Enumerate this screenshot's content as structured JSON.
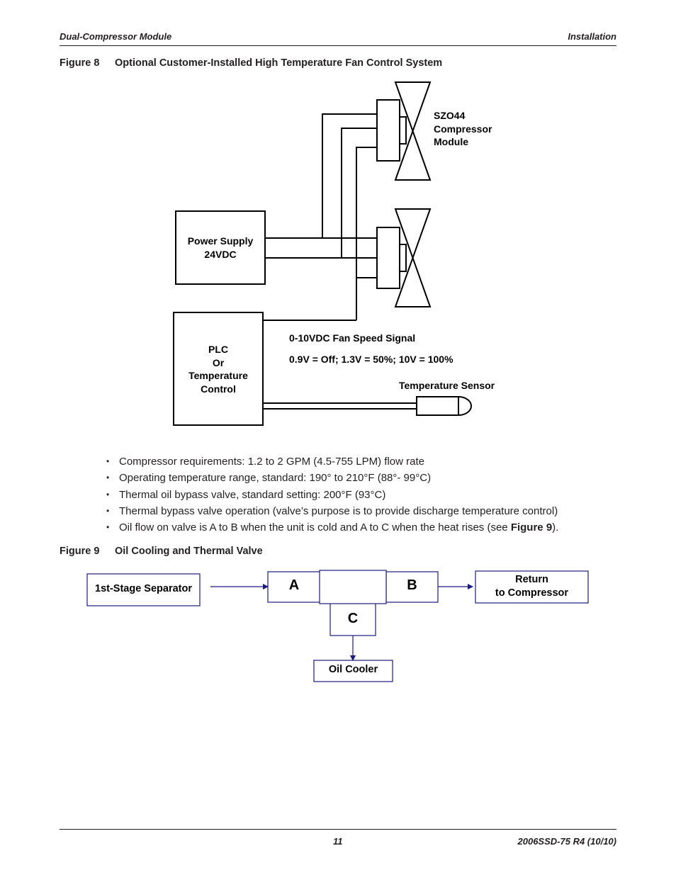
{
  "header": {
    "left": "Dual-Compressor Module",
    "right": "Installation"
  },
  "figure8": {
    "number": "Figure 8",
    "title": "Optional Customer-Installed High Temperature Fan Control System",
    "compressor_label": [
      "SZO44",
      "Compressor",
      "Module"
    ],
    "power_supply": [
      "Power Supply",
      "24VDC"
    ],
    "controller": [
      "PLC",
      "Or",
      "Temperature",
      "Control"
    ],
    "signal_label": "0-10VDC Fan Speed Signal",
    "signal_values": "0.9V = Off; 1.3V = 50%; 10V = 100%",
    "sensor_label": "Temperature Sensor"
  },
  "bullets": [
    {
      "text": "Compressor requirements: 1.2 to 2 GPM (4.5-755 LPM) flow rate"
    },
    {
      "text": "Operating temperature range, standard: 190° to 210°F (88°- 99°C)"
    },
    {
      "text": "Thermal oil bypass valve, standard setting: 200°F (93°C)"
    },
    {
      "text": "Thermal bypass valve operation (valve’s purpose is to provide discharge temperature control)"
    },
    {
      "pre": "Oil flow on valve is A to B when the unit is cold and A to C when the heat rises (see ",
      "bold": "Figure 9",
      "post": ")."
    }
  ],
  "figure9": {
    "number": "Figure 9",
    "title": "Oil Cooling and Thermal Valve",
    "separator": "1st-Stage Separator",
    "port_a": "A",
    "port_b": "B",
    "port_c": "C",
    "return": [
      "Return",
      "to Compressor"
    ],
    "oil_cooler": "Oil Cooler",
    "line_color": "#1a1a80"
  },
  "footer": {
    "page": "11",
    "doc": "2006SSD-75 R4 (10/10)"
  }
}
